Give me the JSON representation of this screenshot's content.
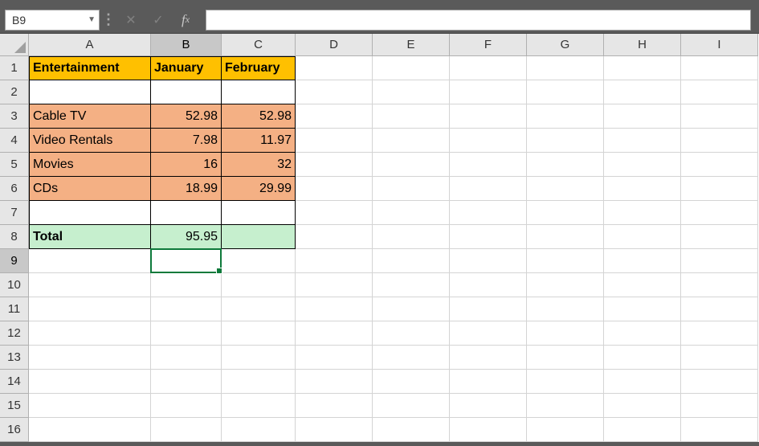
{
  "nameBox": "B9",
  "formulaInput": "",
  "columns": [
    "A",
    "B",
    "C",
    "D",
    "E",
    "F",
    "G",
    "H",
    "I"
  ],
  "activeColumn": "B",
  "rows": [
    1,
    2,
    3,
    4,
    5,
    6,
    7,
    8,
    9,
    10,
    11,
    12,
    13,
    14,
    15,
    16
  ],
  "activeRow": 9,
  "cells": {
    "r1": {
      "A": "Entertainment",
      "B": "January",
      "C": "February"
    },
    "r3": {
      "A": "Cable TV",
      "B": "52.98",
      "C": "52.98"
    },
    "r4": {
      "A": "Video Rentals",
      "B": "7.98",
      "C": "11.97"
    },
    "r5": {
      "A": "Movies",
      "B": "16",
      "C": "32"
    },
    "r6": {
      "A": "CDs",
      "B": "18.99",
      "C": "29.99"
    },
    "r8": {
      "A": "Total",
      "B": "95.95",
      "C": ""
    }
  },
  "selection": {
    "row": 9,
    "col": "B"
  },
  "chart_data": {
    "type": "table",
    "title": "Entertainment",
    "columns": [
      "January",
      "February"
    ],
    "rows": [
      {
        "label": "Cable TV",
        "values": [
          52.98,
          52.98
        ]
      },
      {
        "label": "Video Rentals",
        "values": [
          7.98,
          11.97
        ]
      },
      {
        "label": "Movies",
        "values": [
          16,
          32
        ]
      },
      {
        "label": "CDs",
        "values": [
          18.99,
          29.99
        ]
      }
    ],
    "totals": {
      "January": 95.95
    }
  }
}
